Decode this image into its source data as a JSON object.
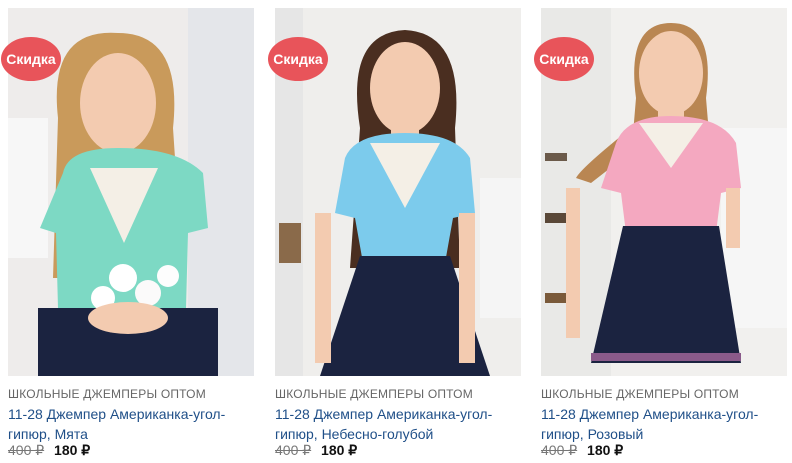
{
  "products": [
    {
      "badge": "Скидка",
      "category": "ШКОЛЬНЫЕ ДЖЕМПЕРЫ ОПТОМ",
      "title": "11-28 Джемпер Американка-угол-гипюр, Мята",
      "old_price": "400 ₽",
      "new_price": "180 ₽",
      "blouse_color": "#7dd9c4",
      "hair_color": "#c99a5b"
    },
    {
      "badge": "Скидка",
      "category": "ШКОЛЬНЫЕ ДЖЕМПЕРЫ ОПТОМ",
      "title": "11-28 Джемпер Американка-угол-гипюр, Небесно-голубой",
      "old_price": "400 ₽",
      "new_price": "180 ₽",
      "blouse_color": "#7ccbec",
      "hair_color": "#4a2e20"
    },
    {
      "badge": "Скидка",
      "category": "ШКОЛЬНЫЕ ДЖЕМПЕРЫ ОПТОМ",
      "title": "11-28 Джемпер Американка-угол-гипюр, Розовый",
      "old_price": "400 ₽",
      "new_price": "180 ₽",
      "blouse_color": "#f4a8c0",
      "hair_color": "#b98652"
    }
  ],
  "colors": {
    "badge": "#e8545a",
    "title_link": "#1f4f88",
    "skirt": "#1b2340"
  }
}
